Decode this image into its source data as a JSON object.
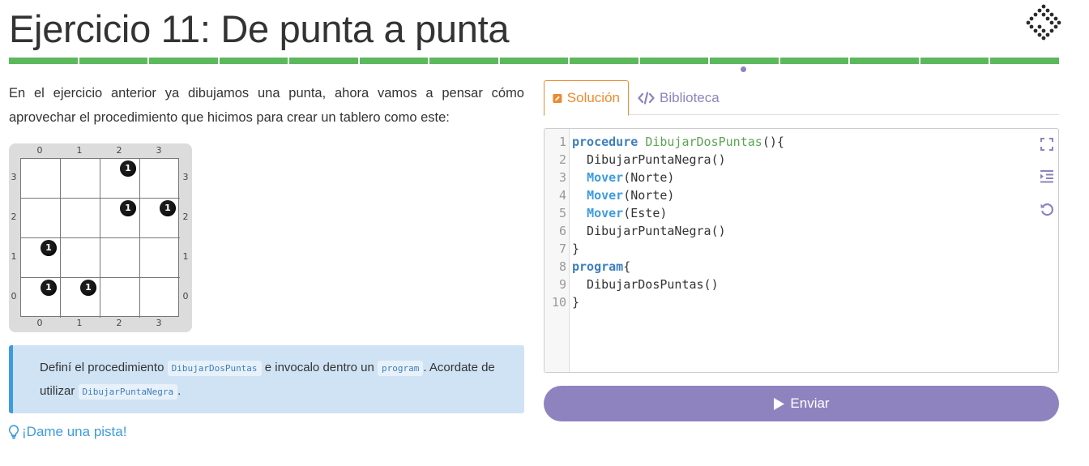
{
  "header": {
    "title": "Ejercicio 11: De punta a punta",
    "progress_segments": 15,
    "current_segment": 11
  },
  "intro": {
    "text": "En el ejercicio anterior ya dibujamos una punta, ahora vamos a pensar cómo aprovechar el procedimiento que hicimos para crear un tablero como este:"
  },
  "board": {
    "columns": [
      "0",
      "1",
      "2",
      "3"
    ],
    "rows": [
      "3",
      "2",
      "1",
      "0"
    ],
    "balls": [
      {
        "col": 2,
        "row": 3,
        "count": "1"
      },
      {
        "col": 2,
        "row": 2,
        "count": "1"
      },
      {
        "col": 3,
        "row": 2,
        "count": "1"
      },
      {
        "col": 0,
        "row": 1,
        "count": "1"
      },
      {
        "col": 0,
        "row": 0,
        "count": "1"
      },
      {
        "col": 1,
        "row": 0,
        "count": "1"
      }
    ],
    "ball_color": "#1a1a1a"
  },
  "tip": {
    "part1": "Definí el procedimiento",
    "code1": "DibujarDosPuntas",
    "part2": "e invocalo dentro un",
    "code2": "program",
    "part3": ". Acordate de utilizar",
    "code3": "DibujarPuntaNegra",
    "part4": "."
  },
  "hint": {
    "label": "¡Dame una pista!",
    "icon": "lightbulb-icon"
  },
  "tabs": {
    "solution": "Solución",
    "library": "Biblioteca"
  },
  "editor": {
    "line_numbers": [
      "1",
      "2",
      "3",
      "4",
      "5",
      "6",
      "7",
      "8",
      "9",
      "10"
    ],
    "lines": {
      "l1_kw": "procedure",
      "l1_fn": "DibujarDosPuntas",
      "l1_rest": "(){",
      "l2": "  DibujarPuntaNegra()",
      "l3_mv": "Mover",
      "l3_rest": "(Norte)",
      "l4_mv": "Mover",
      "l4_rest": "(Norte)",
      "l5_mv": "Mover",
      "l5_rest": "(Este)",
      "l6": "  DibujarPuntaNegra()",
      "l7": "}",
      "l8_kw": "program",
      "l8_rest": "{",
      "l9": "  DibujarDosPuntas()",
      "l10": "}"
    },
    "icons": [
      "fullscreen-icon",
      "indent-icon",
      "reset-icon"
    ]
  },
  "submit": {
    "label": "Enviar"
  },
  "colors": {
    "progress": "#5cb85c",
    "accent": "#8e83be",
    "solution_tab": "#ec8b2f",
    "info": "#3d9be0"
  }
}
